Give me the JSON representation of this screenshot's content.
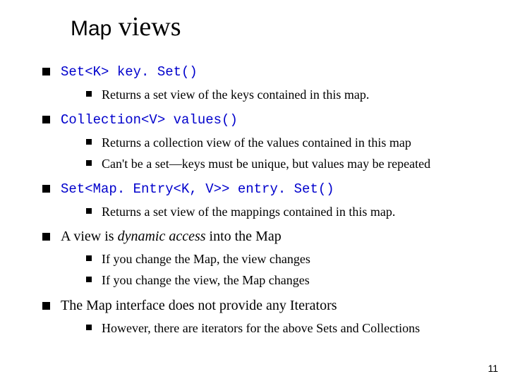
{
  "title": {
    "part1": "Map",
    "part2": " views"
  },
  "bullets": [
    {
      "code": "Set<K> key. Set()",
      "sub": [
        {
          "text": "Returns a set view of the keys contained in this map."
        }
      ]
    },
    {
      "code": "Collection<V> values()",
      "sub": [
        {
          "text": "Returns a collection view of the values contained in this map"
        },
        {
          "text": "Can't be a set—keys must be unique, but values may be repeated"
        }
      ]
    },
    {
      "code": "Set<Map. Entry<K, V>> entry. Set()",
      "sub": [
        {
          "text": "Returns a set view of the mappings contained in this map."
        }
      ]
    },
    {
      "html": "A view is <span class=\"ital\">dynamic access</span> into the Map",
      "sub": [
        {
          "text": "If you change the Map, the view changes"
        },
        {
          "text": "If you change the view, the Map changes"
        }
      ]
    },
    {
      "text": "The Map interface does not provide any Iterators",
      "sub": [
        {
          "text": "However, there are iterators for the above Sets and Collections"
        }
      ]
    }
  ],
  "page_number": "11"
}
